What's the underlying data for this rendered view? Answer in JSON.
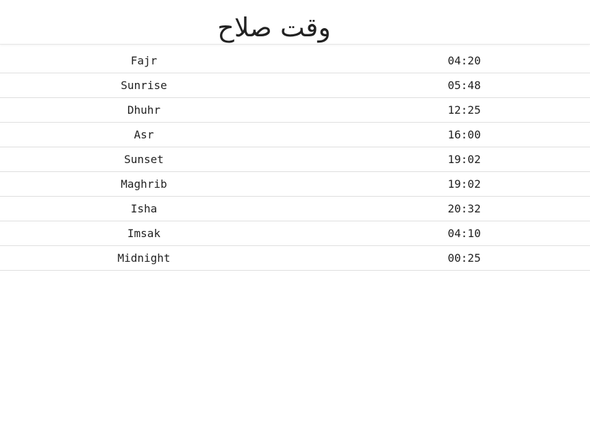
{
  "header": {
    "title": "وقت صلاح"
  },
  "prayer_times": [
    {
      "name": "Fajr",
      "time": "04:20"
    },
    {
      "name": "Sunrise",
      "time": "05:48"
    },
    {
      "name": "Dhuhr",
      "time": "12:25"
    },
    {
      "name": "Asr",
      "time": "16:00"
    },
    {
      "name": "Sunset",
      "time": "19:02"
    },
    {
      "name": "Maghrib",
      "time": "19:02"
    },
    {
      "name": "Isha",
      "time": "20:32"
    },
    {
      "name": "Imsak",
      "time": "04:10"
    },
    {
      "name": "Midnight",
      "time": "00:25"
    }
  ]
}
